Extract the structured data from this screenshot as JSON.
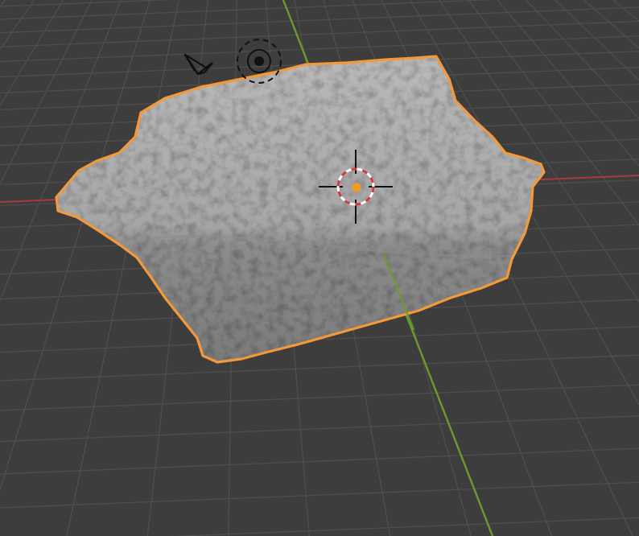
{
  "viewport": {
    "mode": "3d-viewport",
    "shading": "solid",
    "background_color": "#3d3d3d",
    "grid_color": "#4f4f4f",
    "grid_minor_color": "#454545"
  },
  "axes": {
    "x_axis_color": "#a83a44",
    "y_axis_color": "#6d9a2a"
  },
  "selected_object": {
    "kind": "rock-mesh",
    "selected": true,
    "outline_color": "#f4993a",
    "surface_color": "#9a9a9a",
    "origin_color": "#f29a24"
  },
  "overlays": {
    "camera_icon": "camera-icon",
    "light_icon": "light-icon",
    "cursor_icon": "3d-cursor-icon"
  }
}
